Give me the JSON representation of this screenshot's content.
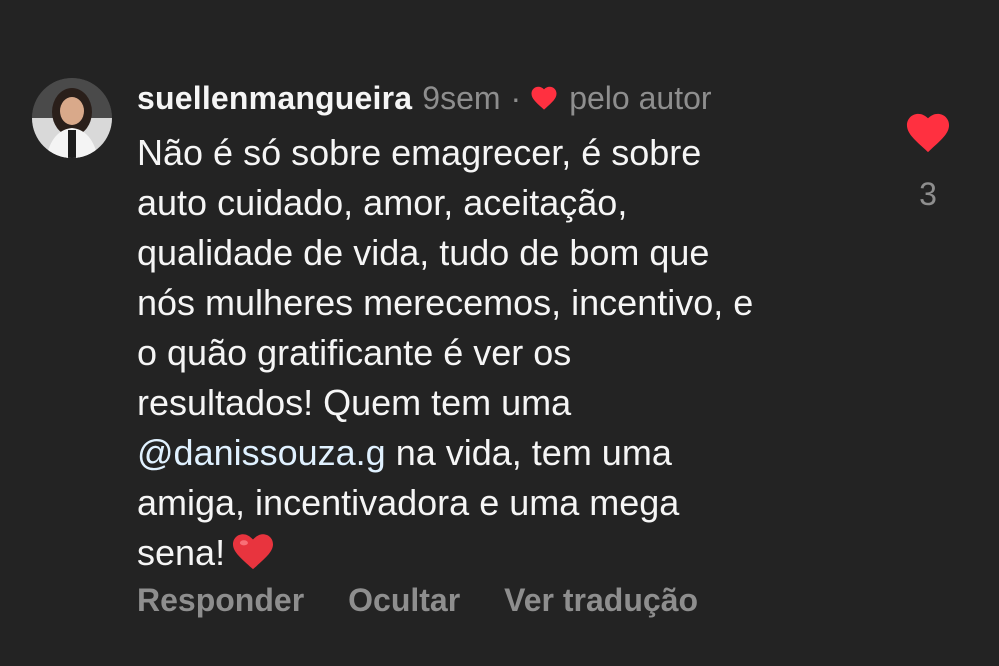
{
  "comment": {
    "username": "suellenmangueira",
    "time": "9sem",
    "separator": "·",
    "liked_by_author": "pelo autor",
    "text_lines": [
      "Não é só sobre emagrecer, é sobre",
      "auto cuidado, amor, aceitação,",
      "qualidade de vida, tudo de bom que",
      "nós mulheres merecemos, incentivo, e",
      "o quão gratificante é ver os",
      "resultados! Quem tem uma"
    ],
    "mention": "@danissouza.g",
    "text_after_mention": " na vida, tem uma",
    "text_lines_end": [
      "amiga, incentivadora e uma mega",
      "sena!"
    ],
    "emoji": "heart-emoji"
  },
  "actions": {
    "reply": "Responder",
    "hide": "Ocultar",
    "translate": "Ver tradução"
  },
  "likes": {
    "count": "3",
    "icon": "heart-icon",
    "liked": true
  },
  "colors": {
    "background": "#232323",
    "text": "#f5f5f5",
    "muted": "#8e8e8e",
    "mention": "#e0f1ff",
    "like_red": "#ff3040"
  }
}
